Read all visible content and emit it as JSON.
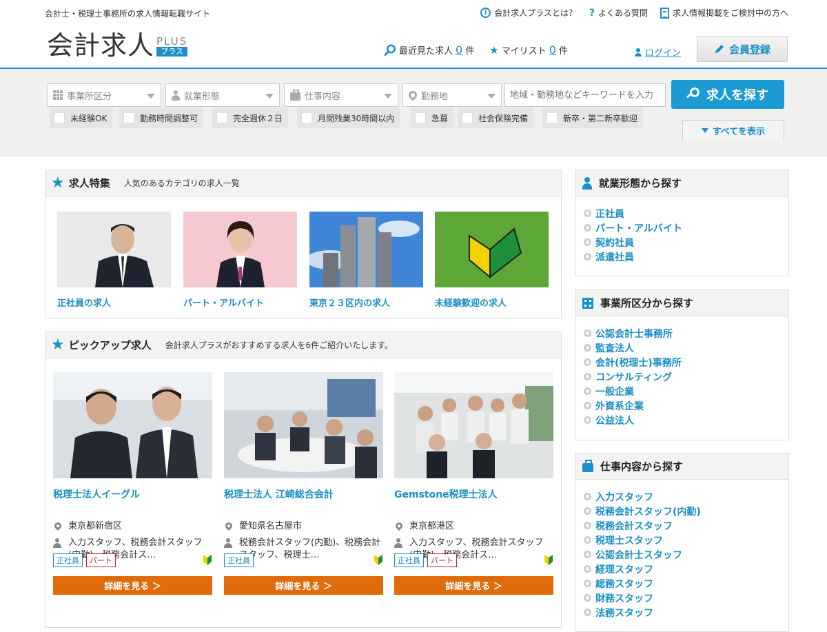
{
  "header": {
    "tagline": "会計士・税理士事務所の求人情報転職サイト",
    "top_links": [
      "会計求人プラスとは？",
      "よくある質問",
      "求人情報掲載をご検討中の方へ"
    ],
    "logo_main": "会計求人",
    "logo_plus": "PLUS",
    "logo_kana": "プラス",
    "recent_label": "最近見た求人",
    "recent_count": "0",
    "recent_unit": "件",
    "mylist_label": "マイリスト",
    "mylist_count": "0",
    "mylist_unit": "件",
    "login": "ログイン",
    "register": "会員登録"
  },
  "search": {
    "selects": [
      "事業所区分",
      "就業形態",
      "仕事内容",
      "勤務地"
    ],
    "keyword_placeholder": "地域・勤務地などキーワードを入力",
    "button": "求人を探す",
    "checkboxes": [
      "未経験OK",
      "勤務時間調整可",
      "完全週休２日",
      "月間残業30時間以内",
      "急募",
      "社会保険完備",
      "新卒・第二新卒歓迎"
    ],
    "show_all": "すべてを表示"
  },
  "featured": {
    "title": "求人特集",
    "desc": "人気のあるカテゴリの求人一覧",
    "items": [
      "正社員の求人",
      "パート・アルバイト",
      "東京２３区内の求人",
      "未経験歓迎の求人"
    ]
  },
  "pickup": {
    "title": "ピックアップ求人",
    "desc": "会計求人プラスがおすすめする求人を6件ご紹介いたします。",
    "detail_label": "詳細を見る ＞",
    "items": [
      {
        "name": "税理士法人イーグル",
        "location": "東京都新宿区",
        "jobs": "入力スタッフ、税務会計スタッフ(内勤)、税務会計ス…",
        "tags": [
          "正社員",
          "パート"
        ]
      },
      {
        "name": "税理士法人 江崎総合会計",
        "location": "愛知県名古屋市",
        "jobs": "税務会計スタッフ(内勤)、税務会計スタッフ、税理士…",
        "tags": [
          "正社員"
        ]
      },
      {
        "name": "Gemstone税理士法人",
        "location": "東京都港区",
        "jobs": "入力スタッフ、税務会計スタッフ(内勤)、税務会計ス…",
        "tags": [
          "正社員",
          "パート"
        ]
      }
    ]
  },
  "sidebar": {
    "employment": {
      "title": "就業形態から探す",
      "items": [
        "正社員",
        "パート・アルバイト",
        "契約社員",
        "派遣社員"
      ]
    },
    "office": {
      "title": "事業所区分から探す",
      "items": [
        "公認会計士事務所",
        "監査法人",
        "会計(税理士)事務所",
        "コンサルティング",
        "一般企業",
        "外資系企業",
        "公益法人"
      ]
    },
    "job": {
      "title": "仕事内容から探す",
      "items": [
        "入力スタッフ",
        "税務会計スタッフ(内勤)",
        "税務会計スタッフ",
        "税理士スタッフ",
        "公認会計士スタッフ",
        "経理スタッフ",
        "総務スタッフ",
        "財務スタッフ",
        "法務スタッフ"
      ]
    }
  },
  "colors": {
    "accent": "#1b8fc7",
    "button_orange": "#e06b0b"
  }
}
